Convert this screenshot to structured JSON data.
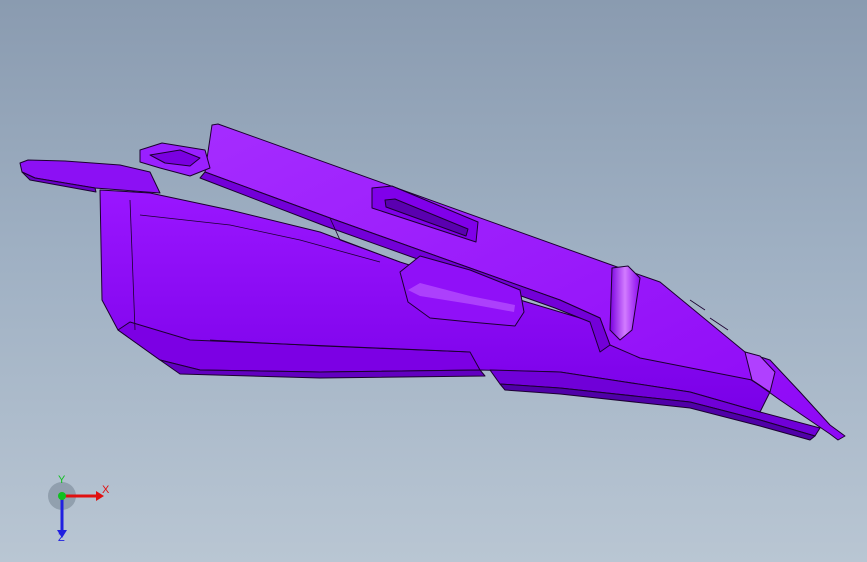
{
  "viewport": {
    "background_top": "#8a9bb0",
    "background_bottom": "#b9c6d3"
  },
  "model": {
    "color": "#8b00f0",
    "edge_color": "#1c0030"
  },
  "triad": {
    "x_label": "X",
    "y_label": "Y",
    "z_label": "Z",
    "x_color": "#e01010",
    "y_color": "#10c020",
    "z_color": "#2020e0"
  }
}
